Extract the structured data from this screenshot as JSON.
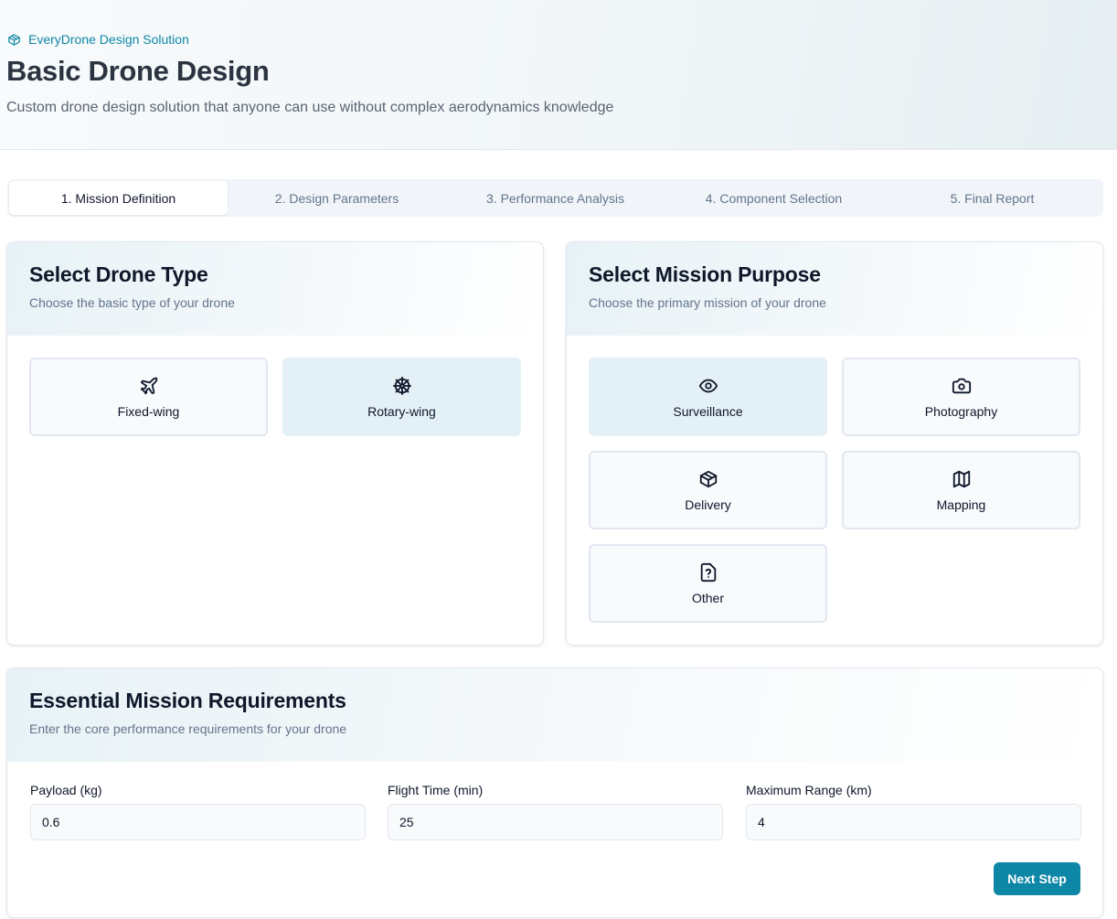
{
  "header": {
    "brand": "EveryDrone Design Solution",
    "title": "Basic Drone Design",
    "subtitle": "Custom drone design solution that anyone can use without complex aerodynamics knowledge"
  },
  "tabs": [
    {
      "label": "1. Mission Definition",
      "active": true
    },
    {
      "label": "2. Design Parameters",
      "active": false
    },
    {
      "label": "3. Performance Analysis",
      "active": false
    },
    {
      "label": "4. Component Selection",
      "active": false
    },
    {
      "label": "5. Final Report",
      "active": false
    }
  ],
  "drone_type": {
    "title": "Select Drone Type",
    "description": "Choose the basic type of your drone",
    "options": [
      {
        "label": "Fixed-wing",
        "icon": "plane-icon",
        "selected": false
      },
      {
        "label": "Rotary-wing",
        "icon": "ship-wheel-icon",
        "selected": true
      }
    ]
  },
  "mission_purpose": {
    "title": "Select Mission Purpose",
    "description": "Choose the primary mission of your drone",
    "options": [
      {
        "label": "Surveillance",
        "icon": "eye-icon",
        "selected": true
      },
      {
        "label": "Photography",
        "icon": "camera-icon",
        "selected": false
      },
      {
        "label": "Delivery",
        "icon": "package-icon",
        "selected": false
      },
      {
        "label": "Mapping",
        "icon": "map-icon",
        "selected": false
      },
      {
        "label": "Other",
        "icon": "file-question-icon",
        "selected": false
      }
    ]
  },
  "requirements": {
    "title": "Essential Mission Requirements",
    "description": "Enter the core performance requirements for your drone",
    "fields": [
      {
        "label": "Payload (kg)",
        "value": "0.6"
      },
      {
        "label": "Flight Time (min)",
        "value": "25"
      },
      {
        "label": "Maximum Range (km)",
        "value": "4"
      }
    ],
    "next_label": "Next Step"
  },
  "colors": {
    "accent": "#0e87a6",
    "selected_option": "#e3f1f7"
  }
}
